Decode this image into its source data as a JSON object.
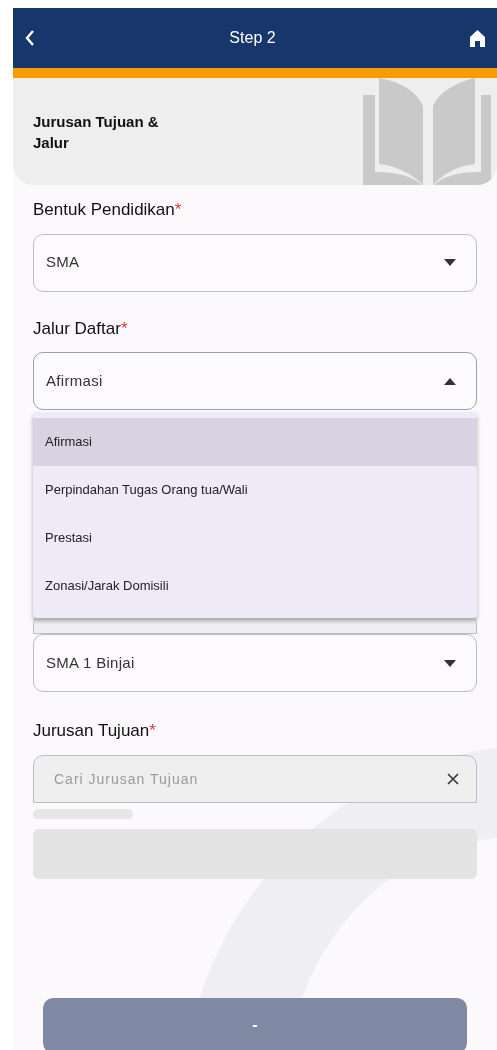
{
  "app_bar": {
    "title": "Step 2"
  },
  "header_card": {
    "title": "Jurusan Tujuan & Jalur"
  },
  "fields": [
    {
      "kind": "select",
      "label": "Bentuk Pendidikan",
      "required": "*",
      "value": "SMA",
      "expanded": false
    },
    {
      "kind": "select",
      "label": "Jalur Daftar",
      "required": "*",
      "value": "Afirmasi",
      "expanded": true,
      "options": [
        {
          "label": "Afirmasi",
          "selected": true
        },
        {
          "label": "Perpindahan Tugas Orang tua/Wali",
          "selected": false
        },
        {
          "label": "Prestasi",
          "selected": false
        },
        {
          "label": "Zonasi/Jarak Domisili",
          "selected": false
        }
      ]
    },
    {
      "kind": "select",
      "value": "SMA 1 Binjai",
      "expanded": false
    },
    {
      "kind": "search",
      "label": "Jurusan Tujuan",
      "required": "*",
      "placeholder": "Cari Jurusan Tujuan"
    }
  ],
  "submit_button": {
    "label": "-",
    "disabled": true
  }
}
